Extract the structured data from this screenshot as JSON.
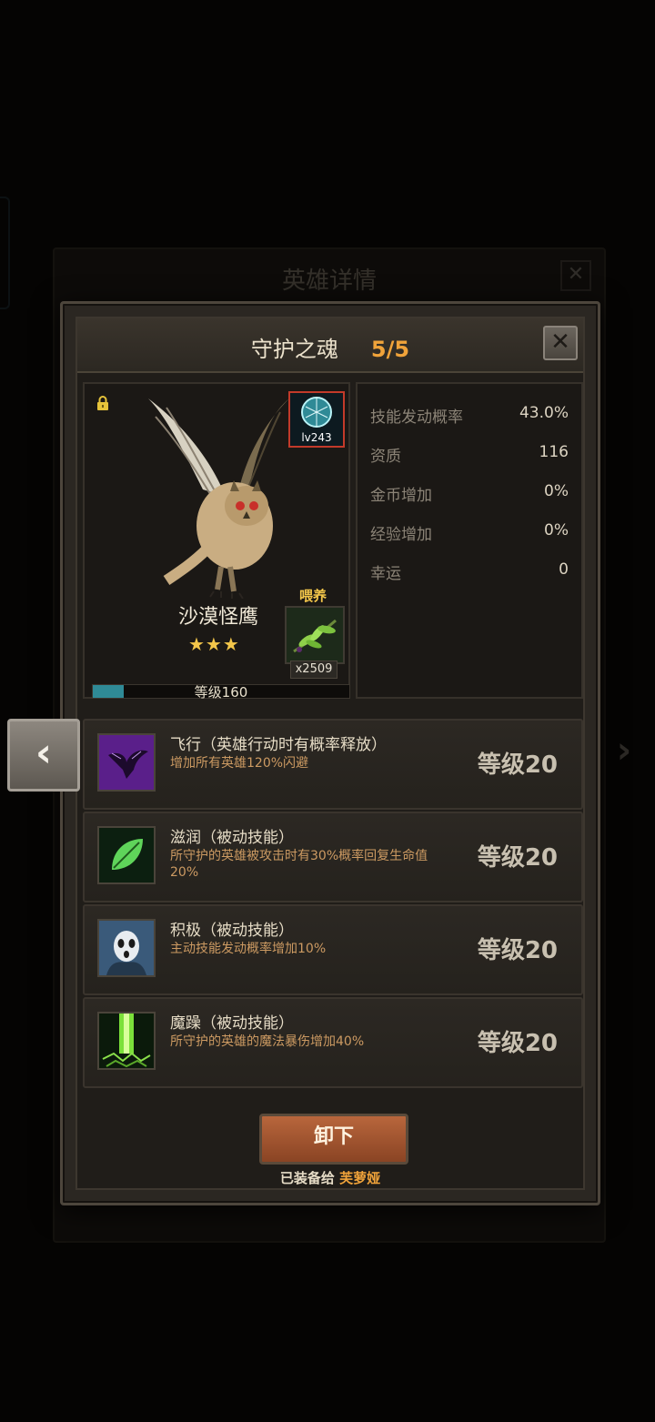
{
  "background": {
    "panel_title": "英雄详情"
  },
  "modal": {
    "title": "守护之魂",
    "count": "5/5",
    "close_symbol": "✕"
  },
  "hero": {
    "name": "沙漠怪鹰",
    "stars": "★★★",
    "soul_level": "lv243",
    "feed_label": "喂养",
    "feed_count": "x2509",
    "level_text": "等级160",
    "xp_fraction": 0.12
  },
  "stats": [
    {
      "label": "技能发动概率",
      "value": "43.0%"
    },
    {
      "label": "资质",
      "value": "116"
    },
    {
      "label": "金币增加",
      "value": "0%"
    },
    {
      "label": "经验增加",
      "value": "0%"
    },
    {
      "label": "幸运",
      "value": "0"
    }
  ],
  "skills": [
    {
      "icon": "raven-flight-icon",
      "title": "飞行（英雄行动时有概率释放）",
      "desc": "增加所有英雄120%闪避",
      "level": "等级20"
    },
    {
      "icon": "leaf-icon",
      "title": "滋润（被动技能）",
      "desc": "所守护的英雄被攻击时有30%概率回复生命值20%",
      "level": "等级20"
    },
    {
      "icon": "mask-icon",
      "title": "积极（被动技能）",
      "desc": "主动技能发动概率增加10%",
      "level": "等级20"
    },
    {
      "icon": "green-beam-icon",
      "title": "魔躁（被动技能）",
      "desc": "所守护的英雄的魔法暴伤增加40%",
      "level": "等级20"
    }
  ],
  "actions": {
    "unequip_label": "卸下",
    "equipped_prefix": "已装备给",
    "equipped_hero": "芙萝娅"
  },
  "nav": {
    "left_arrow": "‹",
    "right_arrow": "›"
  },
  "colors": {
    "accent_orange": "#f0a33a",
    "desc_text": "#cc9a62",
    "button_brown": "#a85a34"
  }
}
